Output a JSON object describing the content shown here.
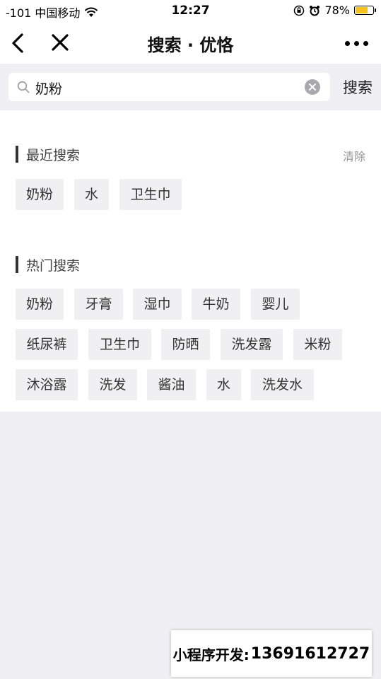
{
  "status_bar": {
    "carrier": "-101 中国移动",
    "time": "12:27",
    "battery_percent": "78%",
    "battery_level": 0.78,
    "icons": [
      "wifi-icon",
      "orientation-lock-icon",
      "alarm-icon",
      "battery-icon"
    ]
  },
  "nav": {
    "title": "搜索 · 优恪",
    "icons": [
      "back-icon",
      "close-icon",
      "more-icon"
    ]
  },
  "search": {
    "value": "奶粉",
    "placeholder": "",
    "button_label": "搜索"
  },
  "recent": {
    "title": "最近搜索",
    "clear_label": "清除",
    "tags": [
      "奶粉",
      "水",
      "卫生巾"
    ]
  },
  "hot": {
    "title": "热门搜索",
    "tags": [
      "奶粉",
      "牙膏",
      "湿巾",
      "牛奶",
      "婴儿",
      "纸尿裤",
      "卫生巾",
      "防晒",
      "洗发露",
      "米粉",
      "沐浴露",
      "洗发",
      "酱油",
      "水",
      "洗发水"
    ]
  },
  "watermark": {
    "label": "小程序开发:",
    "phone": "13691612727"
  },
  "colors": {
    "page_bg": "#efeff4",
    "tag_bg": "#f0f0f2",
    "battery": "#f5c21b"
  }
}
